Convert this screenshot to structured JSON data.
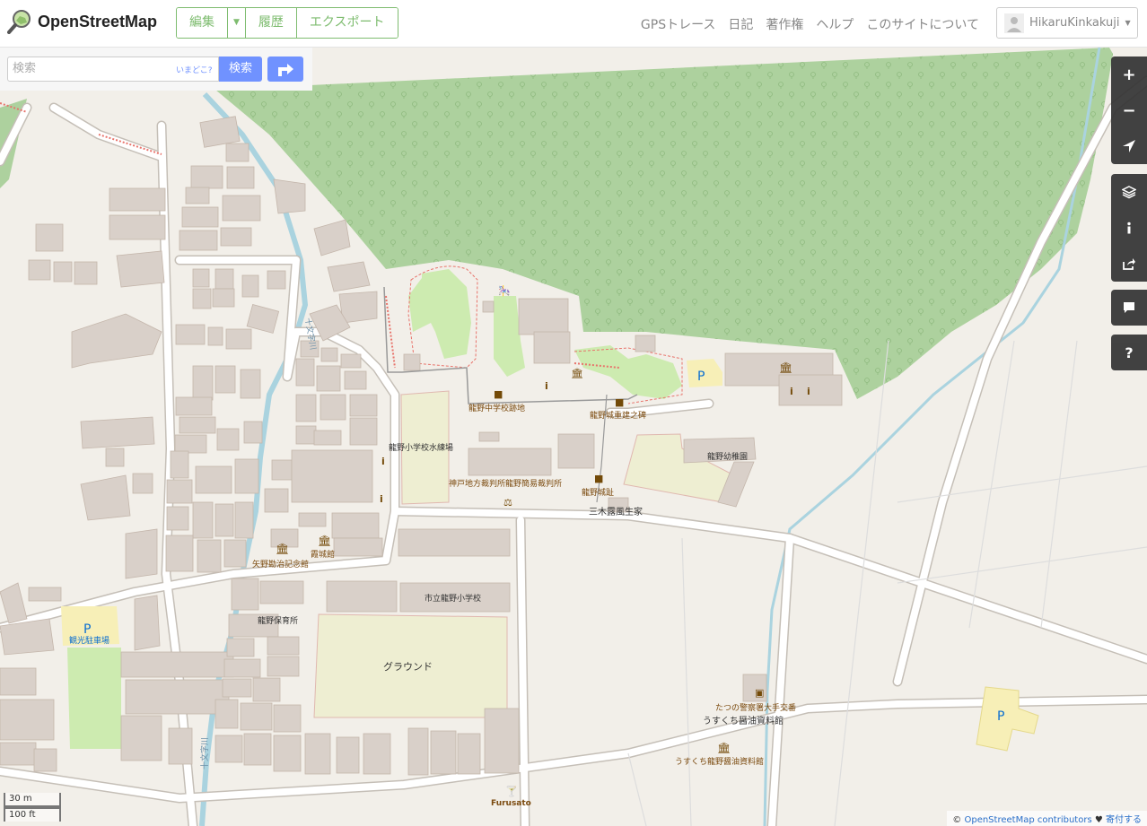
{
  "header": {
    "logo_text": "OpenStreetMap",
    "edit_label": "編集",
    "history_label": "履歴",
    "export_label": "エクスポート",
    "nav": [
      "GPSトレース",
      "日記",
      "著作権",
      "ヘルプ",
      "このサイトについて"
    ],
    "username": "HikaruKinkakuji"
  },
  "search": {
    "placeholder": "検索",
    "where_am_i": "いまどこ?",
    "button": "検索"
  },
  "map": {
    "colors": {
      "background": "#f2efe9",
      "forest": "#add19e",
      "building": "#d9d0c9",
      "grass": "#cdebb0",
      "field": "#eeeed2",
      "water": "#aad3df",
      "parking": "#f7efb7"
    },
    "labels": {
      "stream1": "十文字川",
      "stream2": "十文字川",
      "junior_high_ruins": "龍野中学校跡地",
      "castle_monument": "龍野城重建之碑",
      "pool": "龍野小学校水練場",
      "kindergarten": "龍野幼稚園",
      "court": "神戸地方裁判所龍野簡易裁判所",
      "castle_ruins": "龍野城趾",
      "miki_house": "三木露風生家",
      "kajo_hall": "霞城館",
      "yano_museum": "矢野勘治記念館",
      "elementary": "市立龍野小学校",
      "nursery": "龍野保育所",
      "ground": "グラウンド",
      "tourist_parking": "観光駐車場",
      "police_box": "たつの警察署大手交番",
      "soy_museum_1": "うすくち醤油資料館",
      "soy_museum_2": "うすくち龍野醤油資料館",
      "furusato": "Furusato"
    }
  },
  "controls": [
    "zoom-in",
    "zoom-out",
    "locate",
    "layers",
    "info",
    "share",
    "note",
    "help"
  ],
  "scale": {
    "metric": "30 m",
    "imperial": "100 ft"
  },
  "attribution": {
    "prefix": "©",
    "link": "OpenStreetMap contributors",
    "heart": "♥",
    "donate": "寄付する"
  }
}
